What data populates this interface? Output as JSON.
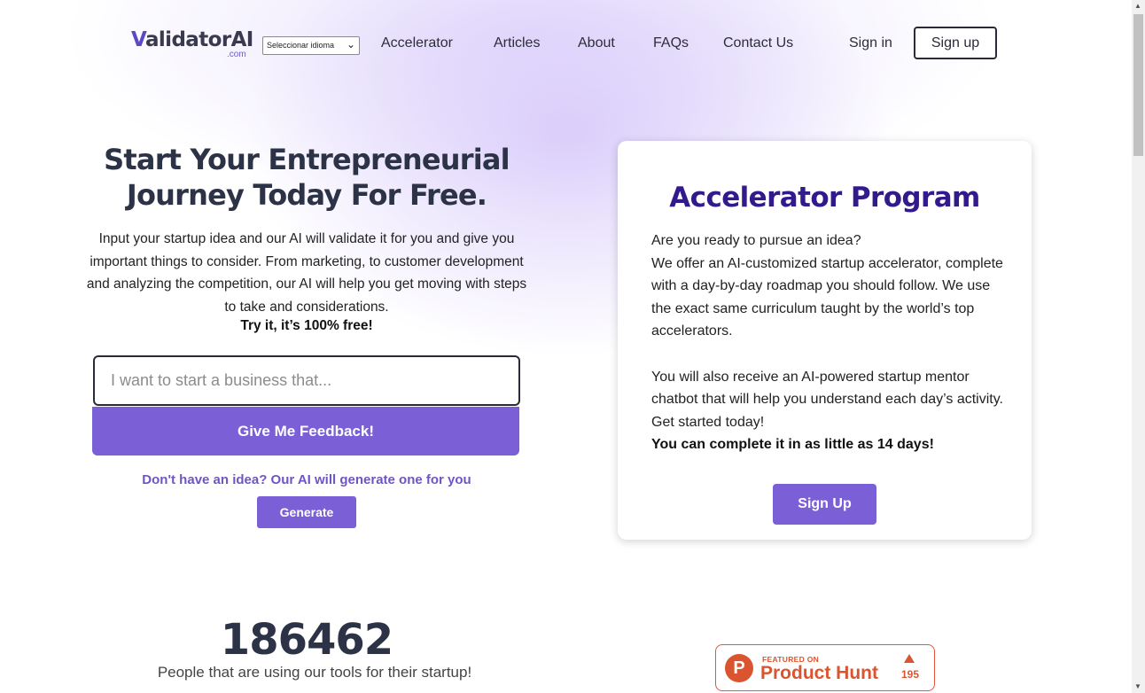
{
  "header": {
    "logo_word": "Validator",
    "logo_v": "V",
    "logo_rest": "alidator",
    "logo_ai": "AI",
    "logo_dotcom": ".com",
    "language_select": "Seleccionar idioma",
    "nav": [
      {
        "label": "Accelerator"
      },
      {
        "label": "Articles"
      },
      {
        "label": "About"
      },
      {
        "label": "FAQs"
      },
      {
        "label": "Contact Us"
      }
    ],
    "sign_in": "Sign in",
    "sign_up": "Sign up"
  },
  "hero": {
    "title_line1": "Start Your Entrepreneurial",
    "title_line2": "Journey Today For Free.",
    "description": "Input your startup idea and our AI will validate it for you and give you important things to consider. From marketing, to customer development and analyzing the competition, our AI will help you get moving with steps to take and considerations.",
    "free_note": "Try it, it’s 100% free!",
    "input_placeholder": "I want to start a business that...",
    "feedback_button": "Give Me Feedback!",
    "generate_hint": "Don't have an idea? Our AI will generate one for you",
    "generate_button": "Generate"
  },
  "accelerator": {
    "title": "Accelerator Program",
    "question": "Are you ready to pursue an idea?",
    "paragraph1": "We offer an AI-customized startup accelerator, complete with a day-by-day roadmap you should follow. We use the exact same curriculum taught by the world’s top accelerators.",
    "paragraph2": "You will also receive an AI-powered startup mentor chatbot that will help you understand each day’s activity. Get started today!",
    "highlight": "You can complete it in as little as 14 days!",
    "signup_button": "Sign Up"
  },
  "stats": {
    "users_count": "186462",
    "users_label": "People that are using our tools for their startup!"
  },
  "product_hunt": {
    "featured": "FEATURED ON",
    "name": "Product Hunt",
    "logo_letter": "P",
    "votes": "195"
  },
  "colors": {
    "accent": "#7b5fd6",
    "title_dark": "#2d3347",
    "accelerator_title": "#321a8c",
    "product_hunt": "#da552f"
  }
}
